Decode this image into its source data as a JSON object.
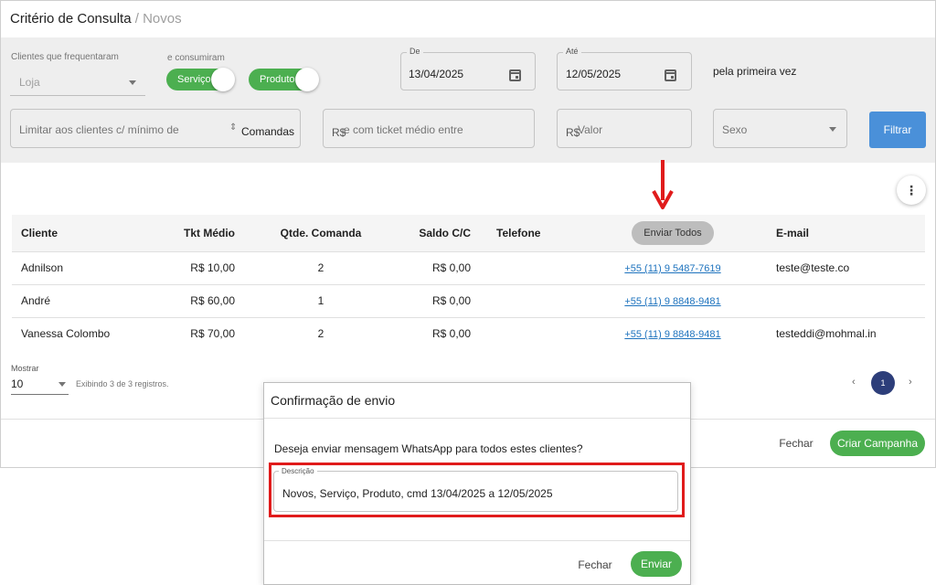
{
  "header": {
    "title": "Critério de Consulta",
    "separator": " / ",
    "subtitle": "Novos"
  },
  "filters": {
    "frequentaram_label": "Clientes que frequentaram",
    "loja_placeholder": "Loja",
    "consumiram_label": "e consumiram",
    "toggle_servico": "Serviço",
    "toggle_produto": "Produto",
    "de_label": "De",
    "de_value": "13/04/2025",
    "ate_label": "Até",
    "ate_value": "12/05/2025",
    "primeira_vez": "pela primeira vez",
    "limitar_placeholder": "Limitar aos clientes c/ mínimo de",
    "comandas_suffix": "Comandas",
    "ticket_prefix": "R$",
    "ticket_placeholder": "e com ticket médio entre",
    "valor_prefix": "R$",
    "valor_placeholder": "Valor",
    "sexo_placeholder": "Sexo",
    "filtrar_button": "Filtrar"
  },
  "table": {
    "headers": [
      "Cliente",
      "Tkt Médio",
      "Qtde. Comanda",
      "Saldo C/C",
      "Telefone",
      "Enviar Todos",
      "E-mail"
    ],
    "rows": [
      {
        "cliente": "Adnilson",
        "tkt": "R$ 10,00",
        "qtde": "2",
        "saldo": "R$ 0,00",
        "telefone": "+55 (11) 9 5487-7619",
        "email": "teste@teste.co"
      },
      {
        "cliente": "André",
        "tkt": "R$ 60,00",
        "qtde": "1",
        "saldo": "R$ 0,00",
        "telefone": "+55 (11) 9 8848-9481",
        "email": ""
      },
      {
        "cliente": "Vanessa Colombo",
        "tkt": "R$ 70,00",
        "qtde": "2",
        "saldo": "R$ 0,00",
        "telefone": "+55 (11) 9 8848-9481",
        "email": "testeddi@mohmal.in"
      }
    ]
  },
  "pagination": {
    "mostrar_label": "Mostrar",
    "mostrar_value": "10",
    "exibindo": "Exibindo 3 de 3 registros.",
    "prev": "‹",
    "current_page": "1",
    "next": "›"
  },
  "footer": {
    "fechar": "Fechar",
    "criar_campanha": "Criar Campanha"
  },
  "dialog": {
    "title": "Confirmação de envio",
    "message": "Deseja enviar mensagem WhatsApp para todos estes clientes?",
    "descricao_label": "Descrição",
    "descricao_value": "Novos, Serviço, Produto, cmd 13/04/2025 a 12/05/2025",
    "fechar": "Fechar",
    "enviar": "Enviar"
  },
  "colors": {
    "accent_green": "#4caf50",
    "filter_blue": "#4a90d9",
    "highlight_red": "#e01b1b",
    "pager_navy": "#2d3e7a"
  }
}
